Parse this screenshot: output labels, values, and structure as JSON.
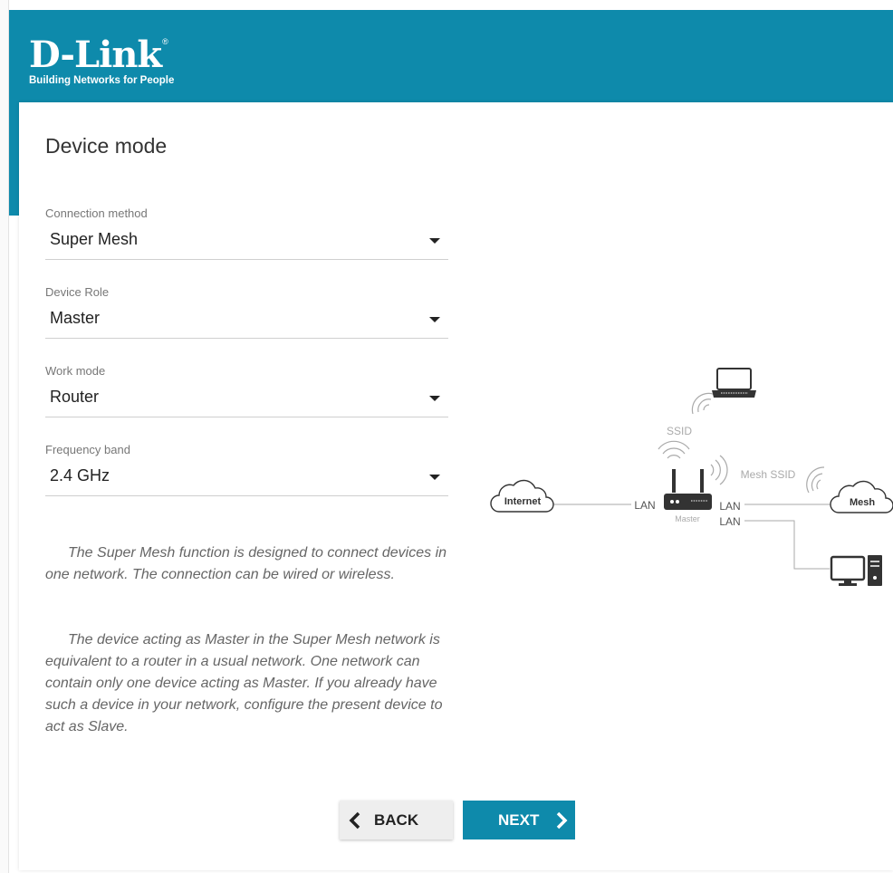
{
  "brand": {
    "name": "D-Link",
    "registered": "®",
    "tagline": "Building Networks for People"
  },
  "page": {
    "title": "Device mode"
  },
  "fields": [
    {
      "label": "Connection method",
      "value": "Super Mesh"
    },
    {
      "label": "Device Role",
      "value": "Master"
    },
    {
      "label": "Work mode",
      "value": "Router"
    },
    {
      "label": "Frequency band",
      "value": "2.4 GHz"
    }
  ],
  "description": [
    "The Super Mesh function is designed to connect devices in one network. The connection can be wired or wireless.",
    "The device acting as Master in the Super Mesh network is equivalent to a router in a usual network. One network can contain only one device acting as Master. If you already have such a device in your network, configure the present device to act as Slave."
  ],
  "diagram": {
    "internet": "Internet",
    "mesh": "Mesh",
    "ssid": "SSID",
    "mesh_ssid": "Mesh SSID",
    "lan_left": "LAN",
    "lan_right_1": "LAN",
    "lan_right_2": "LAN",
    "master": "Master"
  },
  "buttons": {
    "back": "BACK",
    "next": "NEXT"
  },
  "colors": {
    "brand": "#0e8aab",
    "diagram_gray": "#aaaaaa",
    "icon_dark": "#333333"
  },
  "icons": [
    "chevron-left-icon",
    "chevron-right-icon",
    "laptop-icon",
    "router-icon",
    "desktop-computer-icon",
    "cloud-icon",
    "wifi-signal-icon"
  ]
}
